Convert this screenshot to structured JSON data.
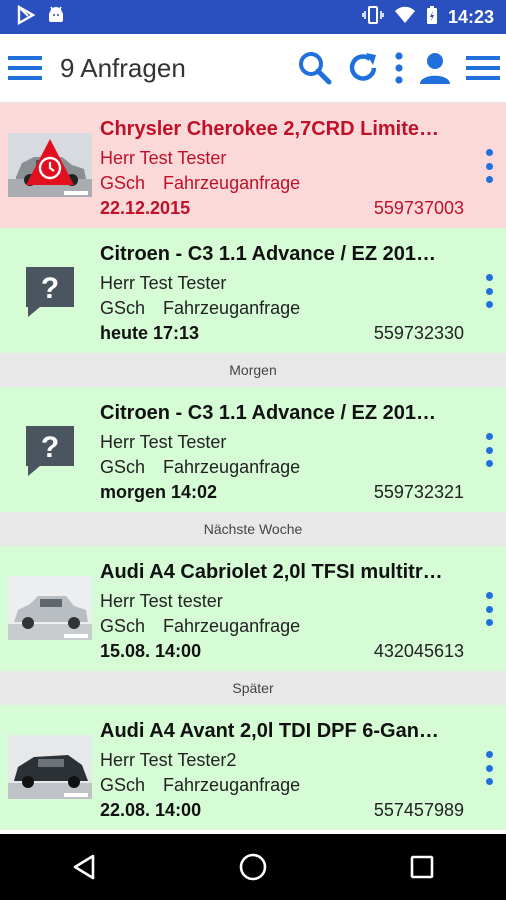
{
  "status_bar": {
    "time": "14:23"
  },
  "app_bar": {
    "title": "9 Anfragen"
  },
  "items": [
    {
      "title": "Chrysler Cherokee 2,7CRD Limite…",
      "contact": "Herr Test Tester",
      "user": "GSch",
      "type": "Fahrzeuganfrage",
      "date": "22.12.2015",
      "number": "559737003"
    },
    {
      "title": "Citroen - C3 1.1 Advance / EZ 201…",
      "contact": "Herr Test Tester",
      "user": "GSch",
      "type": "Fahrzeuganfrage",
      "date": "heute 17:13",
      "number": "559732330"
    },
    {
      "title": "Citroen - C3 1.1 Advance / EZ 201…",
      "contact": "Herr Test Tester",
      "user": "GSch",
      "type": "Fahrzeuganfrage",
      "date": "morgen 14:02",
      "number": "559732321"
    },
    {
      "title": "Audi A4 Cabriolet 2,0l TFSI multitr…",
      "contact": "Herr Test tester",
      "user": "GSch",
      "type": "Fahrzeuganfrage",
      "date": "15.08. 14:00",
      "number": "432045613"
    },
    {
      "title": "Audi A4 Avant 2,0l TDI DPF 6-Gan…",
      "contact": "Herr Test Tester2",
      "user": "GSch",
      "type": "Fahrzeuganfrage",
      "date": "22.08. 14:00",
      "number": "557457989"
    }
  ],
  "sections": {
    "tomorrow": "Morgen",
    "next_week": "Nächste Woche",
    "later": "Später"
  },
  "colors": {
    "status_bar": "#2a4fbf",
    "accent": "#1f6fdc",
    "alert_bg": "#fbd9d9",
    "ok_bg": "#d6fcd6",
    "alert_text": "#c0112a"
  }
}
